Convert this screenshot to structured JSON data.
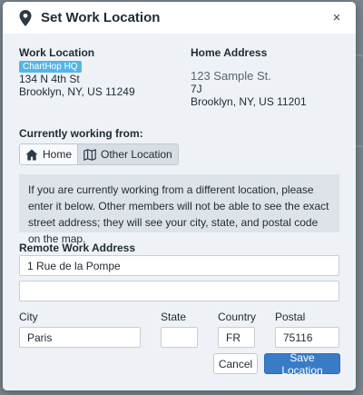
{
  "modal": {
    "title": "Set Work Location",
    "close_label": "×"
  },
  "work_location": {
    "heading": "Work Location",
    "badge": "ChartHop HQ",
    "line1": "134 N 4th St",
    "line2": "Brooklyn, NY, US 11249"
  },
  "home_address": {
    "heading": "Home Address",
    "line1": "123 Sample St.",
    "line2": "7J",
    "line3": "Brooklyn, NY, US 11201"
  },
  "working_from": {
    "label": "Currently working from:",
    "options": [
      {
        "label": "Home",
        "icon": "home-icon",
        "selected": false
      },
      {
        "label": "Other Location",
        "icon": "map-icon",
        "selected": true
      }
    ]
  },
  "info": {
    "text": "If you are currently working from a different location, please enter it below. Other members will not be able to see the exact street address; they will see your city, state, and postal code on the map."
  },
  "remote_address": {
    "label": "Remote Work Address",
    "line1_value": "1 Rue de la Pompe",
    "line2_value": ""
  },
  "fields": {
    "city_label": "City",
    "city_value": "Paris",
    "state_label": "State",
    "state_value": "",
    "country_label": "Country",
    "country_value": "FR",
    "postal_label": "Postal",
    "postal_value": "75116"
  },
  "buttons": {
    "cancel": "Cancel",
    "save": "Save Location"
  },
  "colors": {
    "accent": "#3a7bc8",
    "badge": "#55b5e8",
    "body_bg": "#eef2f6",
    "info_bg": "#dde3e9"
  }
}
